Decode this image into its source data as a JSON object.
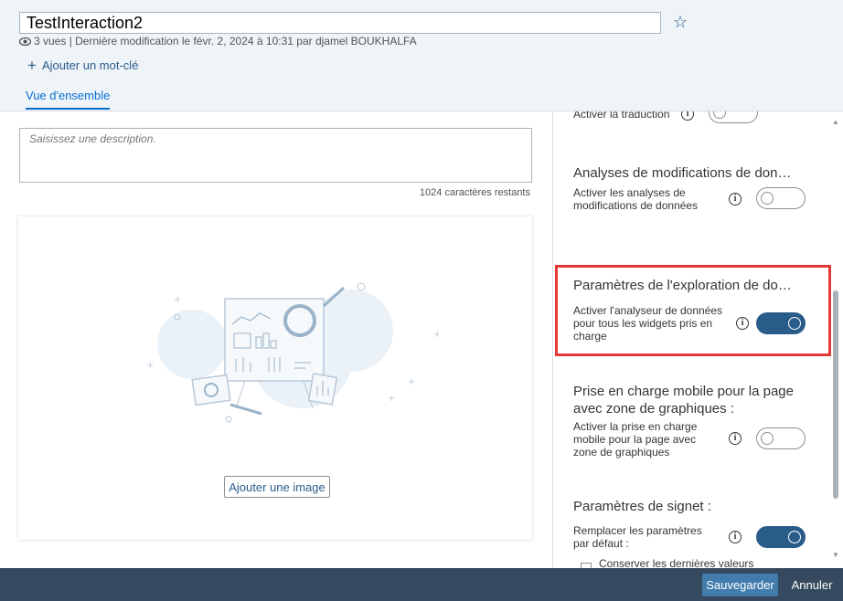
{
  "header": {
    "title": "TestInteraction2",
    "meta": "3 vues | Dernière modification le févr. 2, 2024 à 10:31 par djamel BOUKHALFA",
    "add_tag": "Ajouter un mot-clé",
    "tab": "Vue d'ensemble",
    "star_icon": "star-outline"
  },
  "main": {
    "description_placeholder": "Saisissez une description.",
    "chars_remaining": "1024 caractères restants",
    "add_image": "Ajouter une image"
  },
  "settings": {
    "translation_label": "Activer la traduction",
    "data_change": {
      "title": "Analyses de modifications de don…",
      "label_line1": "Activer les analyses de",
      "label_line2": "modifications de données"
    },
    "explorer": {
      "title": "Paramètres de l'exploration de do…",
      "label_line1": "Activer l'analyseur de données",
      "label_line2": "pour tous les widgets pris en",
      "label_line3": "charge"
    },
    "mobile": {
      "title_line1": "Prise en charge mobile pour la page",
      "title_line2": "avec zone de graphiques :",
      "label_line1": "Activer la prise en charge",
      "label_line2": "mobile pour la page avec",
      "label_line3": "zone de graphiques"
    },
    "bookmark": {
      "title": "Paramètres de signet :",
      "label_line1": "Remplacer les paramètres",
      "label_line2": "par défaut :",
      "checkbox_label": "Conserver les dernières valeurs"
    }
  },
  "footer": {
    "save": "Sauvegarder",
    "cancel": "Annuler"
  },
  "colors": {
    "accent": "#2a5c8a",
    "highlight": "#e53935",
    "footer": "#354a5f"
  }
}
